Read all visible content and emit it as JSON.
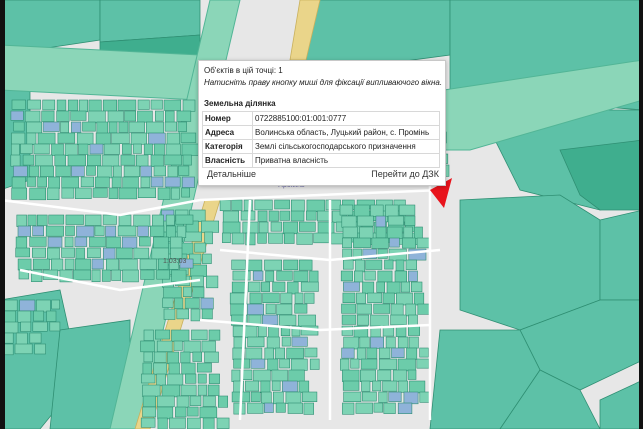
{
  "popup": {
    "objects_count": "Об'єктів в цій точці: 1",
    "hint": "Натисніть праву кнопку миші для фіксації випливаючого вікна.",
    "section_title": "Земельна ділянка",
    "rows": [
      {
        "label": "Номер",
        "value": "0722885100:01:001:0777"
      },
      {
        "label": "Адреса",
        "value": "Волинська область, Луцький район, с. Промінь"
      },
      {
        "label": "Категорія",
        "value": "Землі сільськогосподарського призначення"
      },
      {
        "label": "Власність",
        "value": "Приватна власність"
      }
    ],
    "details_link": "Детальніше",
    "dzk_link": "Перейти до ДЗК"
  },
  "map": {
    "street_label": "Промінь",
    "parcel_label": "1:03:03",
    "colors": {
      "background": "#e6e6e6",
      "parcel_fill": "#6cccaa",
      "parcel_stroke": "#2f8f73",
      "forest_fill": "#3fae8e",
      "road_band": "#8bd6b8",
      "highway": "#ead58a",
      "marker": "#e8141c"
    }
  }
}
